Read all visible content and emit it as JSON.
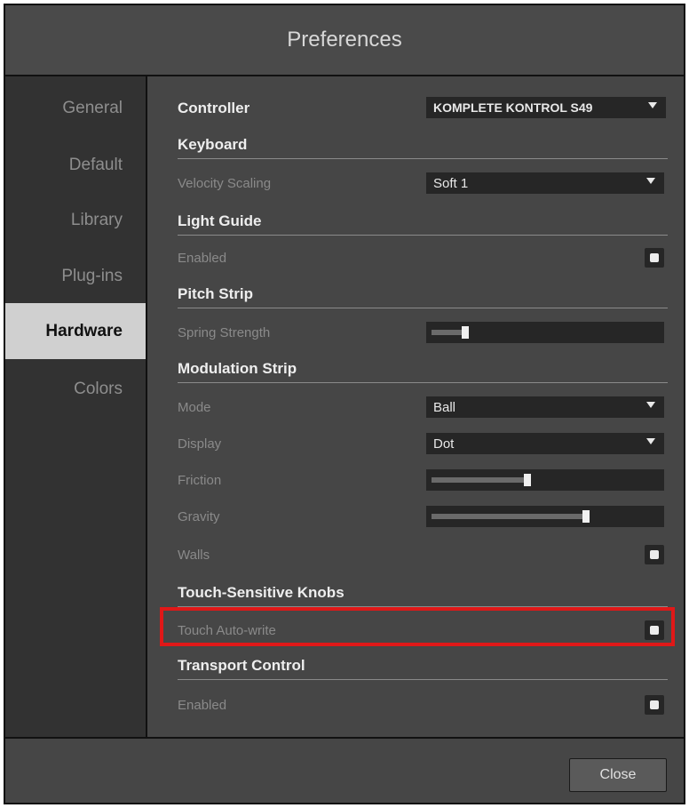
{
  "window": {
    "title": "Preferences"
  },
  "sidebar": {
    "items": [
      {
        "label": "General"
      },
      {
        "label": "Default"
      },
      {
        "label": "Library"
      },
      {
        "label": "Plug-ins"
      },
      {
        "label": "Hardware",
        "active": true
      },
      {
        "label": "Colors"
      }
    ]
  },
  "controller": {
    "label": "Controller",
    "value": "KOMPLETE KONTROL S49"
  },
  "keyboard": {
    "title": "Keyboard",
    "velocity_label": "Velocity Scaling",
    "velocity_value": "Soft 1"
  },
  "light_guide": {
    "title": "Light Guide",
    "enabled_label": "Enabled",
    "enabled": true
  },
  "pitch_strip": {
    "title": "Pitch Strip",
    "spring_label": "Spring Strength",
    "spring_value": 0.15
  },
  "modulation_strip": {
    "title": "Modulation Strip",
    "mode_label": "Mode",
    "mode_value": "Ball",
    "display_label": "Display",
    "display_value": "Dot",
    "friction_label": "Friction",
    "friction_value": 0.42,
    "gravity_label": "Gravity",
    "gravity_value": 0.68,
    "walls_label": "Walls",
    "walls": true
  },
  "touch_knobs": {
    "title": "Touch-Sensitive Knobs",
    "auto_write_label": "Touch Auto-write",
    "auto_write": true
  },
  "transport": {
    "title": "Transport Control",
    "enabled_label": "Enabled",
    "enabled": true
  },
  "footer": {
    "close_label": "Close"
  },
  "colors": {
    "highlight": "#e01818",
    "active_tab_bg": "#d0d0d0"
  }
}
